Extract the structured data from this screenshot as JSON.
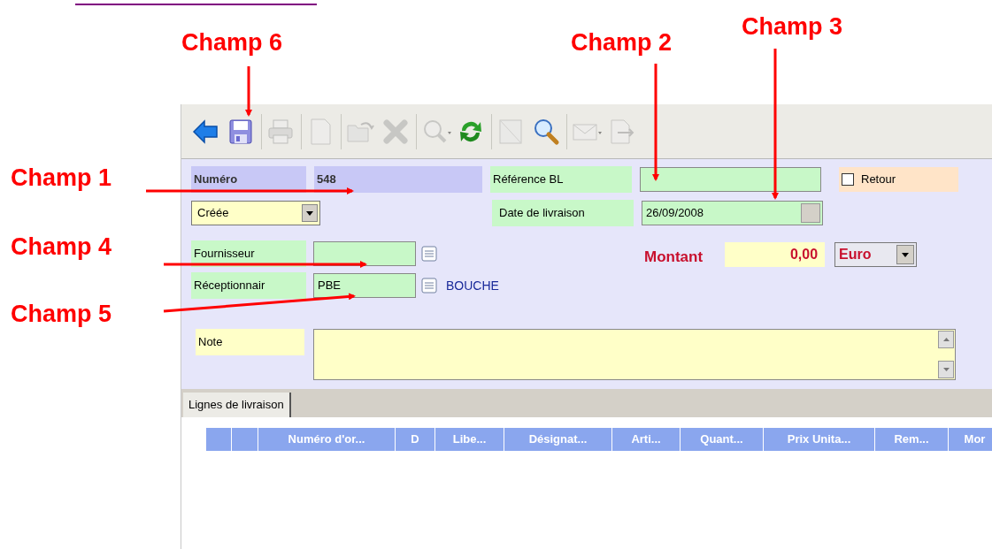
{
  "annotations": [
    {
      "label": "Champ 6"
    },
    {
      "label": "Champ 2"
    },
    {
      "label": "Champ 3"
    },
    {
      "label": "Champ 1"
    },
    {
      "label": "Champ 4"
    },
    {
      "label": "Champ 5"
    }
  ],
  "toolbar": [
    {
      "kind": "back",
      "disabled": false
    },
    {
      "kind": "save",
      "disabled": false
    },
    {
      "kind": "print",
      "disabled": true
    },
    {
      "kind": "new",
      "disabled": true
    },
    {
      "kind": "open",
      "disabled": true
    },
    {
      "kind": "delete",
      "disabled": true
    },
    {
      "kind": "zoom",
      "disabled": true
    },
    {
      "kind": "refresh",
      "disabled": false
    },
    {
      "kind": "blank",
      "disabled": true
    },
    {
      "kind": "search",
      "disabled": false
    },
    {
      "kind": "mail",
      "disabled": true
    },
    {
      "kind": "export",
      "disabled": true
    }
  ],
  "form": {
    "numero_label": "Numéro",
    "numero_value": "548",
    "status": "Créée",
    "fournisseur_label": "Fournisseur",
    "receptionnaire_label": "Réceptionnair",
    "receptionnaire_value": "PBE",
    "receptionnaire_name": "BOUCHE",
    "reference_label": "Référence BL",
    "date_label": "Date de livraison",
    "date_value": "26/09/2008",
    "retour_label": "Retour",
    "retour_checked": false,
    "montant_label": "Montant",
    "montant_value": "0,00",
    "currency": "Euro",
    "note_label": "Note"
  },
  "tabs": [
    {
      "label": "Lignes de livraison",
      "selected": true
    }
  ],
  "table": {
    "columns": [
      {
        "kind": "blank"
      },
      {
        "kind": "blank"
      },
      {
        "kind": "text",
        "label": "Numéro d'or..."
      },
      {
        "kind": "text",
        "label": "D"
      },
      {
        "kind": "text",
        "label": "Libe..."
      },
      {
        "kind": "text",
        "label": "Désignat..."
      },
      {
        "kind": "text",
        "label": "Arti..."
      },
      {
        "kind": "text",
        "label": "Quant..."
      },
      {
        "kind": "text",
        "label": "Prix Unita..."
      },
      {
        "kind": "text",
        "label": "Rem..."
      },
      {
        "kind": "text",
        "label": "Mor"
      }
    ]
  }
}
